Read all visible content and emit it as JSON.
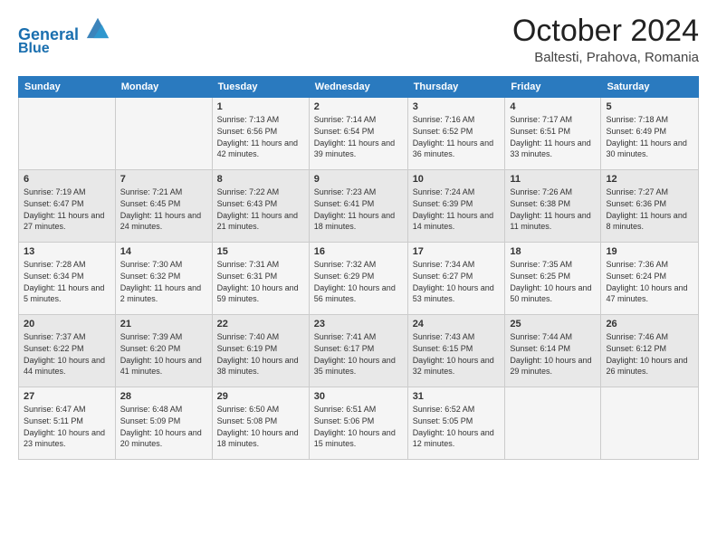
{
  "header": {
    "logo_line1": "General",
    "logo_line2": "Blue",
    "month": "October 2024",
    "location": "Baltesti, Prahova, Romania"
  },
  "days_of_week": [
    "Sunday",
    "Monday",
    "Tuesday",
    "Wednesday",
    "Thursday",
    "Friday",
    "Saturday"
  ],
  "weeks": [
    [
      {
        "day": "",
        "info": ""
      },
      {
        "day": "",
        "info": ""
      },
      {
        "day": "1",
        "info": "Sunrise: 7:13 AM\nSunset: 6:56 PM\nDaylight: 11 hours and 42 minutes."
      },
      {
        "day": "2",
        "info": "Sunrise: 7:14 AM\nSunset: 6:54 PM\nDaylight: 11 hours and 39 minutes."
      },
      {
        "day": "3",
        "info": "Sunrise: 7:16 AM\nSunset: 6:52 PM\nDaylight: 11 hours and 36 minutes."
      },
      {
        "day": "4",
        "info": "Sunrise: 7:17 AM\nSunset: 6:51 PM\nDaylight: 11 hours and 33 minutes."
      },
      {
        "day": "5",
        "info": "Sunrise: 7:18 AM\nSunset: 6:49 PM\nDaylight: 11 hours and 30 minutes."
      }
    ],
    [
      {
        "day": "6",
        "info": "Sunrise: 7:19 AM\nSunset: 6:47 PM\nDaylight: 11 hours and 27 minutes."
      },
      {
        "day": "7",
        "info": "Sunrise: 7:21 AM\nSunset: 6:45 PM\nDaylight: 11 hours and 24 minutes."
      },
      {
        "day": "8",
        "info": "Sunrise: 7:22 AM\nSunset: 6:43 PM\nDaylight: 11 hours and 21 minutes."
      },
      {
        "day": "9",
        "info": "Sunrise: 7:23 AM\nSunset: 6:41 PM\nDaylight: 11 hours and 18 minutes."
      },
      {
        "day": "10",
        "info": "Sunrise: 7:24 AM\nSunset: 6:39 PM\nDaylight: 11 hours and 14 minutes."
      },
      {
        "day": "11",
        "info": "Sunrise: 7:26 AM\nSunset: 6:38 PM\nDaylight: 11 hours and 11 minutes."
      },
      {
        "day": "12",
        "info": "Sunrise: 7:27 AM\nSunset: 6:36 PM\nDaylight: 11 hours and 8 minutes."
      }
    ],
    [
      {
        "day": "13",
        "info": "Sunrise: 7:28 AM\nSunset: 6:34 PM\nDaylight: 11 hours and 5 minutes."
      },
      {
        "day": "14",
        "info": "Sunrise: 7:30 AM\nSunset: 6:32 PM\nDaylight: 11 hours and 2 minutes."
      },
      {
        "day": "15",
        "info": "Sunrise: 7:31 AM\nSunset: 6:31 PM\nDaylight: 10 hours and 59 minutes."
      },
      {
        "day": "16",
        "info": "Sunrise: 7:32 AM\nSunset: 6:29 PM\nDaylight: 10 hours and 56 minutes."
      },
      {
        "day": "17",
        "info": "Sunrise: 7:34 AM\nSunset: 6:27 PM\nDaylight: 10 hours and 53 minutes."
      },
      {
        "day": "18",
        "info": "Sunrise: 7:35 AM\nSunset: 6:25 PM\nDaylight: 10 hours and 50 minutes."
      },
      {
        "day": "19",
        "info": "Sunrise: 7:36 AM\nSunset: 6:24 PM\nDaylight: 10 hours and 47 minutes."
      }
    ],
    [
      {
        "day": "20",
        "info": "Sunrise: 7:37 AM\nSunset: 6:22 PM\nDaylight: 10 hours and 44 minutes."
      },
      {
        "day": "21",
        "info": "Sunrise: 7:39 AM\nSunset: 6:20 PM\nDaylight: 10 hours and 41 minutes."
      },
      {
        "day": "22",
        "info": "Sunrise: 7:40 AM\nSunset: 6:19 PM\nDaylight: 10 hours and 38 minutes."
      },
      {
        "day": "23",
        "info": "Sunrise: 7:41 AM\nSunset: 6:17 PM\nDaylight: 10 hours and 35 minutes."
      },
      {
        "day": "24",
        "info": "Sunrise: 7:43 AM\nSunset: 6:15 PM\nDaylight: 10 hours and 32 minutes."
      },
      {
        "day": "25",
        "info": "Sunrise: 7:44 AM\nSunset: 6:14 PM\nDaylight: 10 hours and 29 minutes."
      },
      {
        "day": "26",
        "info": "Sunrise: 7:46 AM\nSunset: 6:12 PM\nDaylight: 10 hours and 26 minutes."
      }
    ],
    [
      {
        "day": "27",
        "info": "Sunrise: 6:47 AM\nSunset: 5:11 PM\nDaylight: 10 hours and 23 minutes."
      },
      {
        "day": "28",
        "info": "Sunrise: 6:48 AM\nSunset: 5:09 PM\nDaylight: 10 hours and 20 minutes."
      },
      {
        "day": "29",
        "info": "Sunrise: 6:50 AM\nSunset: 5:08 PM\nDaylight: 10 hours and 18 minutes."
      },
      {
        "day": "30",
        "info": "Sunrise: 6:51 AM\nSunset: 5:06 PM\nDaylight: 10 hours and 15 minutes."
      },
      {
        "day": "31",
        "info": "Sunrise: 6:52 AM\nSunset: 5:05 PM\nDaylight: 10 hours and 12 minutes."
      },
      {
        "day": "",
        "info": ""
      },
      {
        "day": "",
        "info": ""
      }
    ]
  ]
}
